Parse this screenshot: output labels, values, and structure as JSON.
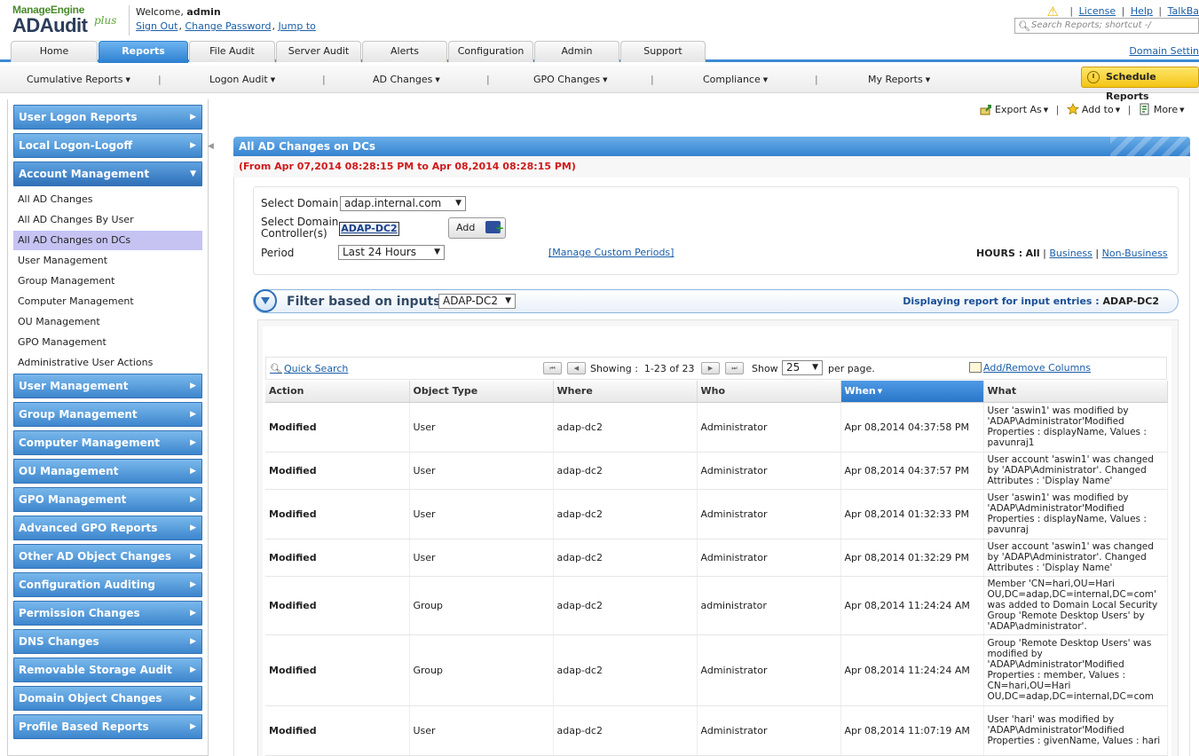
{
  "header": {
    "logo_brand": "ManageEngine",
    "logo_product": "ADAudit",
    "logo_plus": "plus",
    "welcome_prefix": "Welcome,",
    "username": "admin",
    "links": [
      "Sign Out",
      "Change Password",
      "Jump to"
    ],
    "top_links": [
      "License",
      "Help",
      "TalkBa"
    ],
    "search_placeholder": "Search Reports; shortcut -/"
  },
  "tabs": [
    {
      "label": "Home",
      "active": false
    },
    {
      "label": "Reports",
      "active": true
    },
    {
      "label": "File Audit",
      "active": false
    },
    {
      "label": "Server Audit",
      "active": false
    },
    {
      "label": "Alerts",
      "active": false
    },
    {
      "label": "Configuration",
      "active": false
    },
    {
      "label": "Admin",
      "active": false
    },
    {
      "label": "Support",
      "active": false
    }
  ],
  "domain_settings": "Domain Settin",
  "subnav": [
    "Cumulative Reports",
    "Logon Audit",
    "AD Changes",
    "GPO Changes",
    "Compliance",
    "My Reports"
  ],
  "schedule_label": "Schedule Reports",
  "sidebar": {
    "head_top": [
      "User Logon Reports",
      "Local Logon-Logoff"
    ],
    "open_section": "Account Management",
    "items": [
      "All AD Changes",
      "All AD Changes By User",
      "All AD Changes on DCs",
      "User Management",
      "Group Management",
      "Computer Management",
      "OU Management",
      "GPO Management",
      "Administrative User Actions"
    ],
    "selected_item": "All AD Changes on DCs",
    "head_bottom": [
      "User Management",
      "Group Management",
      "Computer Management",
      "OU Management",
      "GPO Management",
      "Advanced GPO Reports",
      "Other AD Object Changes",
      "Configuration Auditing",
      "Permission Changes",
      "DNS Changes",
      "Removable Storage Audit",
      "Domain Object Changes",
      "Profile Based Reports"
    ]
  },
  "actions": [
    "Export As",
    "Add to",
    "More"
  ],
  "report": {
    "title": "All AD Changes on DCs",
    "range": "(From Apr 07,2014 08:28:15 PM to Apr 08,2014 08:28:15 PM)",
    "select_domain_label": "Select Domain",
    "domain_value": "adap.internal.com",
    "select_dc_label_1": "Select Domain",
    "select_dc_label_2": "Controller(s)",
    "dc_value": "ADAP-DC2",
    "add_label": "Add",
    "period_label": "Period",
    "period_value": "Last 24 Hours",
    "custom_periods": "[Manage Custom Periods]",
    "hours_label": "HOURS :",
    "hours_all": "All",
    "hours_business": "Business",
    "hours_nonbusiness": "Non-Business"
  },
  "filter": {
    "label": "Filter based on inputs",
    "value": "ADAP-DC2",
    "displaying_label": "Displaying report for input entries :",
    "displaying_value": "ADAP-DC2"
  },
  "grid_toolbar": {
    "quick_search": "Quick Search",
    "showing_label": "Showing :",
    "showing_value": "1-23 of 23",
    "show_label": "Show",
    "page_size": "25",
    "per_page": "per page.",
    "add_remove_columns": "Add/Remove Columns"
  },
  "table": {
    "columns": [
      "Action",
      "Object Type",
      "Where",
      "Who",
      "When",
      "What"
    ],
    "sorted_column": "When",
    "rows": [
      {
        "action": "Modified",
        "type": "User",
        "where": "adap-dc2",
        "who": "Administrator",
        "when": "Apr 08,2014 04:37:58 PM",
        "what": "User 'aswin1' was modified by 'ADAP\\Administrator'Modified Properties : displayName, Values : pavunraj1"
      },
      {
        "action": "Modified",
        "type": "User",
        "where": "adap-dc2",
        "who": "Administrator",
        "when": "Apr 08,2014 04:37:57 PM",
        "what": "User account 'aswin1' was changed by 'ADAP\\Administrator'. Changed Attributes : 'Display Name'"
      },
      {
        "action": "Modified",
        "type": "User",
        "where": "adap-dc2",
        "who": "Administrator",
        "when": "Apr 08,2014 01:32:33 PM",
        "what": "User 'aswin1' was modified by 'ADAP\\Administrator'Modified Properties : displayName, Values : pavunraj"
      },
      {
        "action": "Modified",
        "type": "User",
        "where": "adap-dc2",
        "who": "Administrator",
        "when": "Apr 08,2014 01:32:29 PM",
        "what": "User account 'aswin1' was changed by 'ADAP\\Administrator'. Changed Attributes : 'Display Name'"
      },
      {
        "action": "Modified",
        "type": "Group",
        "where": "adap-dc2",
        "who": "administrator",
        "when": "Apr 08,2014 11:24:24 AM",
        "what": "Member 'CN=hari,OU=Hari OU,DC=adap,DC=internal,DC=com' was added to Domain Local Security Group 'Remote Desktop Users' by 'ADAP\\administrator'."
      },
      {
        "action": "Modified",
        "type": "Group",
        "where": "adap-dc2",
        "who": "Administrator",
        "when": "Apr 08,2014 11:24:24 AM",
        "what": "Group 'Remote Desktop Users' was modified by 'ADAP\\Administrator'Modified Properties : member, Values : CN=hari,OU=Hari OU,DC=adap,DC=internal,DC=com"
      },
      {
        "action": "Modified",
        "type": "User",
        "where": "adap-dc2",
        "who": "Administrator",
        "when": "Apr 08,2014 11:07:19 AM",
        "what": "User 'hari' was modified by 'ADAP\\Administrator'Modified Properties : givenName, Values : hari"
      }
    ]
  }
}
